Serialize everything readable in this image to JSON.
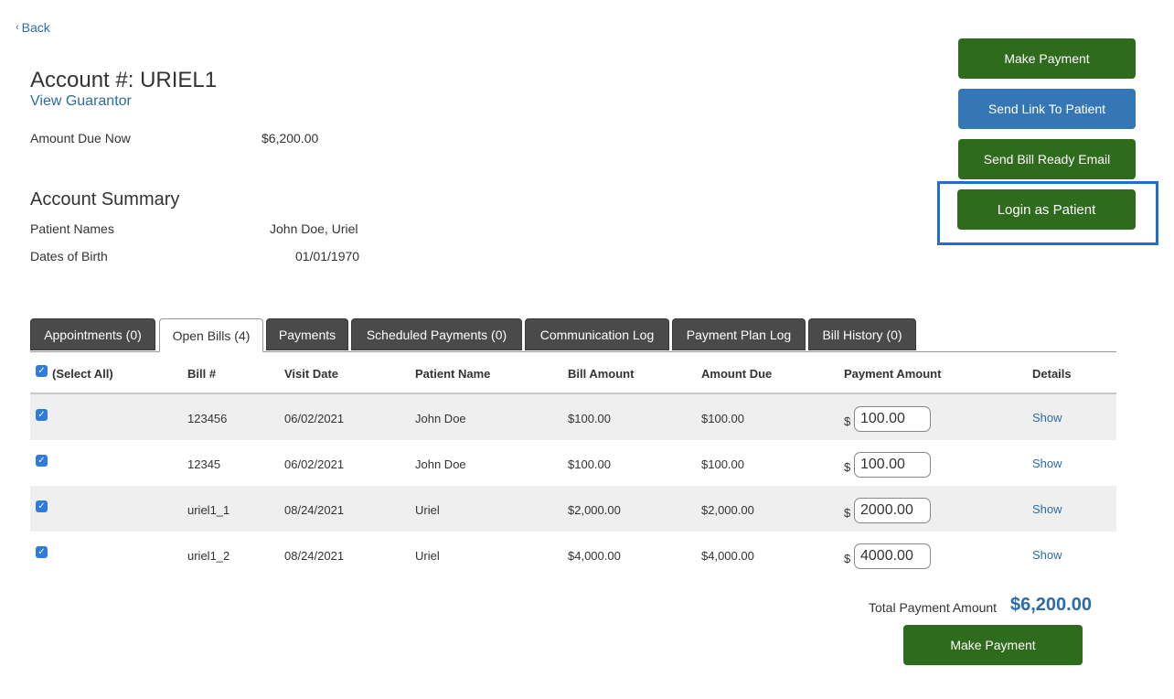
{
  "nav": {
    "back_label": "Back"
  },
  "account": {
    "title": "Account #: URIEL1",
    "view_guarantor": "View Guarantor",
    "amount_due_label": "Amount Due Now",
    "amount_due_value": "$6,200.00"
  },
  "summary": {
    "title": "Account Summary",
    "patient_names_label": "Patient Names",
    "patient_names_value": "John Doe, Uriel",
    "dob_label": "Dates of Birth",
    "dob_value": "01/01/1970"
  },
  "actions": {
    "make_payment": "Make Payment",
    "send_link": "Send Link To Patient",
    "send_bill_email": "Send Bill Ready Email",
    "login_as_patient": "Login as Patient"
  },
  "tabs": [
    {
      "label": "Appointments (0)"
    },
    {
      "label": "Open Bills (4)",
      "active": true
    },
    {
      "label": "Payments"
    },
    {
      "label": "Scheduled Payments (0)"
    },
    {
      "label": "Communication Log"
    },
    {
      "label": "Payment Plan Log"
    },
    {
      "label": "Bill History (0)"
    }
  ],
  "table": {
    "headers": {
      "select_all": "(Select All)",
      "bill": "Bill #",
      "visit_date": "Visit Date",
      "patient_name": "Patient Name",
      "bill_amount": "Bill Amount",
      "amount_due": "Amount Due",
      "payment_amount": "Payment Amount",
      "details": "Details"
    },
    "rows": [
      {
        "bill": "123456",
        "visit_date": "06/02/2021",
        "patient": "John Doe",
        "bill_amount": "$100.00",
        "amount_due": "$100.00",
        "payment": "100.00",
        "details": "Show"
      },
      {
        "bill": "12345",
        "visit_date": "06/02/2021",
        "patient": "John Doe",
        "bill_amount": "$100.00",
        "amount_due": "$100.00",
        "payment": "100.00",
        "details": "Show"
      },
      {
        "bill": "uriel1_1",
        "visit_date": "08/24/2021",
        "patient": "Uriel",
        "bill_amount": "$2,000.00",
        "amount_due": "$2,000.00",
        "payment": "2000.00",
        "details": "Show"
      },
      {
        "bill": "uriel1_2",
        "visit_date": "08/24/2021",
        "patient": "Uriel",
        "bill_amount": "$4,000.00",
        "amount_due": "$4,000.00",
        "payment": "4000.00",
        "details": "Show"
      }
    ],
    "currency_symbol": "$",
    "check_glyph": "✓"
  },
  "footer": {
    "total_label": "Total Payment Amount",
    "total_value": "$6,200.00",
    "make_payment": "Make Payment"
  },
  "colors": {
    "primary_green": "#2e6b1d",
    "primary_blue": "#3577b5",
    "link_blue": "#2b6ca8",
    "highlight_border": "#1f6fd1",
    "tab_dark": "#4a4a4a",
    "checkbox_blue": "#2f7ce0"
  }
}
